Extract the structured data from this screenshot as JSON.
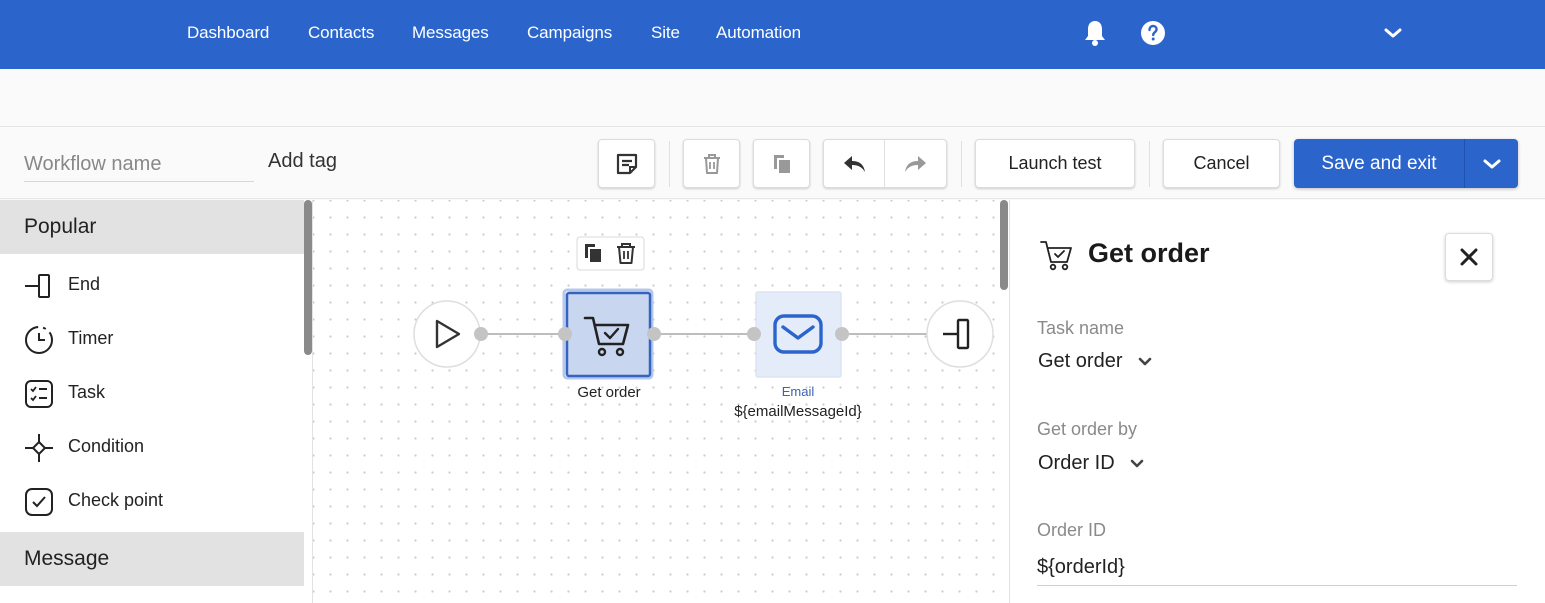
{
  "nav": {
    "items": [
      "Dashboard",
      "Contacts",
      "Messages",
      "Campaigns",
      "Site",
      "Automation"
    ]
  },
  "toolbar": {
    "workflow_name_placeholder": "Workflow name",
    "add_tag": "Add tag",
    "launch_test": "Launch test",
    "cancel": "Cancel",
    "save_and_exit": "Save and exit"
  },
  "sidebar": {
    "sections": [
      "Popular",
      "Message"
    ],
    "items": [
      {
        "label": "End",
        "icon": "end-icon"
      },
      {
        "label": "Timer",
        "icon": "timer-icon"
      },
      {
        "label": "Task",
        "icon": "task-icon"
      },
      {
        "label": "Condition",
        "icon": "condition-icon"
      },
      {
        "label": "Check point",
        "icon": "check-point-icon"
      }
    ]
  },
  "canvas": {
    "get_order_label": "Get order",
    "email_type": "Email",
    "email_label": "${emailMessageId}"
  },
  "panel": {
    "title": "Get order",
    "task_name_label": "Task name",
    "task_name_value": "Get order",
    "get_order_by_label": "Get order by",
    "get_order_by_value": "Order ID",
    "order_id_label": "Order ID",
    "order_id_value": "${orderId}"
  },
  "colors": {
    "brand": "#2b65cc",
    "selected_node": "#c9d6ef",
    "email_node": "#e4ecfa"
  }
}
